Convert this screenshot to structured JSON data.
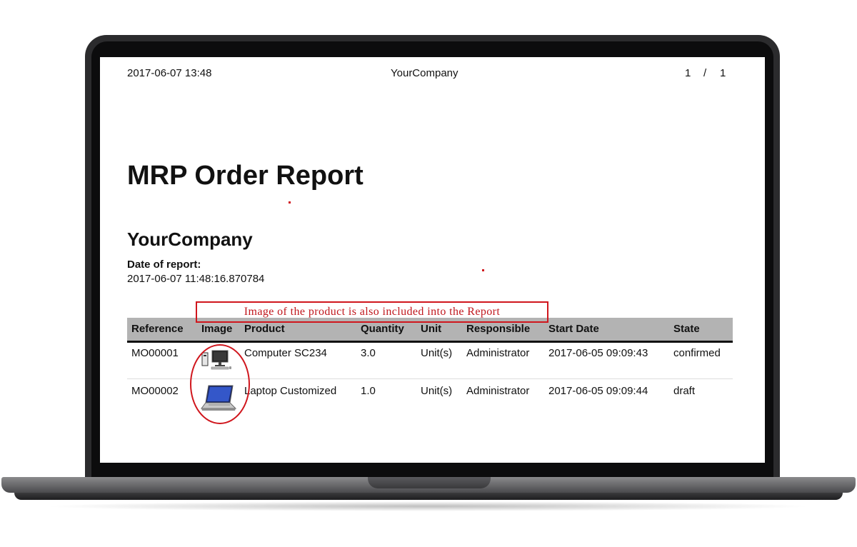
{
  "header": {
    "datetime": "2017-06-07 13:48",
    "company": "YourCompany",
    "page_current": "1",
    "page_sep": "/",
    "page_total": "1"
  },
  "report": {
    "title": "MRP Order Report",
    "company": "YourCompany",
    "date_label": "Date of report:",
    "date_value": "2017-06-07 11:48:16.870784"
  },
  "annotation": "Image of the product is also included into the Report",
  "table": {
    "columns": [
      "Reference",
      "Image",
      "Product",
      "Quantity",
      "Unit",
      "Responsible",
      "Start Date",
      "State"
    ],
    "rows": [
      {
        "reference": "MO00001",
        "image_icon": "desktop-computer-icon",
        "product": "Computer SC234",
        "quantity": "3.0",
        "unit": "Unit(s)",
        "responsible": "Administrator",
        "start_date": "2017-06-05 09:09:43",
        "state": "confirmed"
      },
      {
        "reference": "MO00002",
        "image_icon": "laptop-icon",
        "product": "Laptop Customized",
        "quantity": "1.0",
        "unit": "Unit(s)",
        "responsible": "Administrator",
        "start_date": "2017-06-05 09:09:44",
        "state": "draft"
      }
    ]
  },
  "colors": {
    "annotation_red": "#d0161d",
    "table_header_bg": "#b3b3b3",
    "laptop_bezel": "#2b2b2d"
  }
}
